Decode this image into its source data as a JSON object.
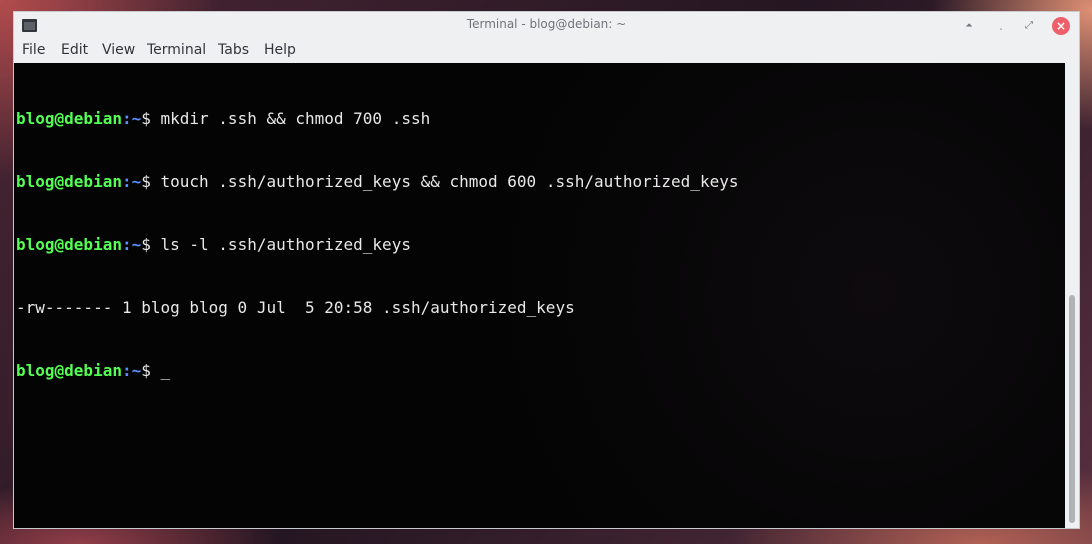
{
  "window": {
    "title": "Terminal - blog@debian: ~"
  },
  "title_buttons": {
    "keep_above": "⏶",
    "minimize": "˯",
    "maximize": "⤢",
    "close": "×"
  },
  "menu": {
    "items": [
      "File",
      "Edit",
      "View",
      "Terminal",
      "Tabs",
      "Help"
    ]
  },
  "terminal": {
    "prompt_user": "blog@debian",
    "prompt_path": ":~",
    "prompt_symbol": "$ ",
    "lines": [
      {
        "type": "command",
        "text": "mkdir .ssh && chmod 700 .ssh"
      },
      {
        "type": "command",
        "text": "touch .ssh/authorized_keys && chmod 600 .ssh/authorized_keys"
      },
      {
        "type": "command",
        "text": "ls -l .ssh/authorized_keys"
      },
      {
        "type": "output",
        "text": "-rw------- 1 blog blog 0 Jul  5 20:58 .ssh/authorized_keys"
      },
      {
        "type": "command",
        "text": ""
      }
    ],
    "cursor": "_"
  },
  "colors": {
    "prompt_user": "#54ff54",
    "prompt_path": "#5c8cff",
    "close_button": "#ed5f6a"
  },
  "icons": {
    "app": "terminal-icon",
    "keep_above": "keep-above-icon",
    "minimize": "minimize-icon",
    "maximize": "maximize-icon",
    "close": "close-icon"
  }
}
